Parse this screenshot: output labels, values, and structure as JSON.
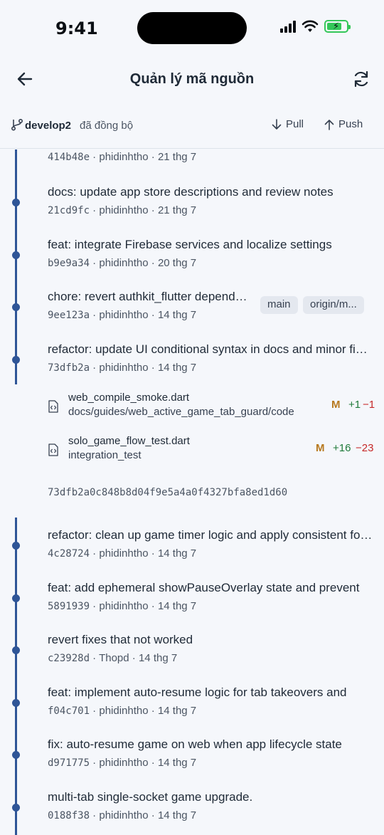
{
  "status_bar": {
    "time": "9:41"
  },
  "header": {
    "title": "Quản lý mã nguồn"
  },
  "branch_bar": {
    "branch": "develop2",
    "sync_status": "đã đồng bộ",
    "pull_label": "Pull",
    "push_label": "Push"
  },
  "commits_top": [
    {
      "message": "",
      "hash": "414b48e",
      "author": "phidinhtho",
      "date": "21 thg 7"
    },
    {
      "message": "docs: update app store descriptions and review notes",
      "hash": "21cd9fc",
      "author": "phidinhtho",
      "date": "21 thg 7"
    },
    {
      "message": "feat: integrate Firebase services and localize settings",
      "hash": "b9e9a34",
      "author": "phidinhtho",
      "date": "20 thg 7"
    },
    {
      "message": "chore: revert authkit_flutter dependency",
      "hash": "9ee123a",
      "author": "phidinhtho",
      "date": "14 thg 7",
      "tags": [
        "main",
        "origin/m..."
      ]
    },
    {
      "message": "refactor: update UI conditional syntax in docs and minor fixes",
      "hash": "73dfb2a",
      "author": "phidinhtho",
      "date": "14 thg 7"
    }
  ],
  "expanded_files": [
    {
      "name": "web_compile_smoke.dart",
      "path": "docs/guides/web_active_game_tab_guard/code",
      "status": "M",
      "additions": "+1",
      "deletions": "−1"
    },
    {
      "name": "solo_game_flow_test.dart",
      "path": "integration_test",
      "status": "M",
      "additions": "+16",
      "deletions": "−23"
    }
  ],
  "full_hash": "73dfb2a0c848b8d04f9e5a4a0f4327bfa8ed1d60",
  "commits_bottom": [
    {
      "message": "refactor: clean up game timer logic and apply consistent formatting",
      "hash": "4c28724",
      "author": "phidinhtho",
      "date": "14 thg 7"
    },
    {
      "message": "feat: add ephemeral showPauseOverlay state and prevent",
      "hash": "5891939",
      "author": "phidinhtho",
      "date": "14 thg 7"
    },
    {
      "message": "revert fixes that not worked",
      "hash": "c23928d",
      "author": "Thopd",
      "date": "14 thg 7"
    },
    {
      "message": "feat: implement auto-resume logic for tab takeovers and",
      "hash": "f04c701",
      "author": "phidinhtho",
      "date": "14 thg 7"
    },
    {
      "message": "fix: auto-resume game on web when app lifecycle state",
      "hash": "d971775",
      "author": "phidinhtho",
      "date": "14 thg 7"
    },
    {
      "message": "multi-tab single-socket game upgrade.",
      "hash": "0188f38",
      "author": "phidinhtho",
      "date": "14 thg 7"
    }
  ],
  "colors": {
    "accent": "#2f5597",
    "modified": "#b7791f",
    "added": "#1f7a3a",
    "deleted": "#c62828",
    "background": "#f5f7fb"
  },
  "icons": [
    "back-arrow-icon",
    "refresh-icon",
    "branch-icon",
    "arrow-down-icon",
    "arrow-up-icon",
    "code-file-icon"
  ]
}
